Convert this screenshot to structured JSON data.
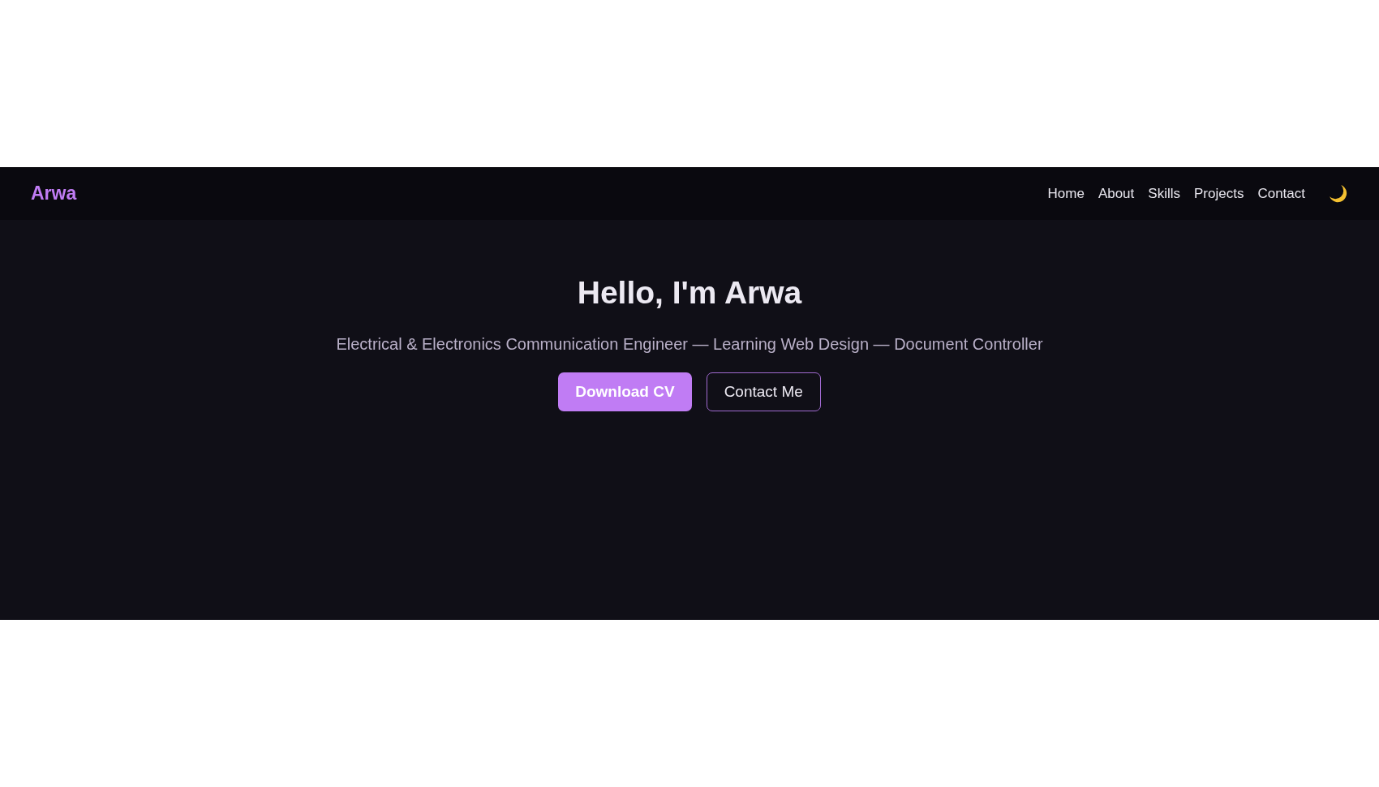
{
  "navbar": {
    "logo": "Arwa",
    "links": [
      {
        "label": "Home"
      },
      {
        "label": "About"
      },
      {
        "label": "Skills"
      },
      {
        "label": "Projects"
      },
      {
        "label": "Contact"
      }
    ],
    "dark_mode": true
  },
  "hero": {
    "title": "Hello, I'm Arwa",
    "subtitle": "Electrical & Electronics Communication Engineer — Learning Web Design — Document Controller",
    "buttons": [
      {
        "label": "Download CV",
        "kind": "primary"
      },
      {
        "label": "Contact Me",
        "kind": "outline"
      }
    ]
  }
}
